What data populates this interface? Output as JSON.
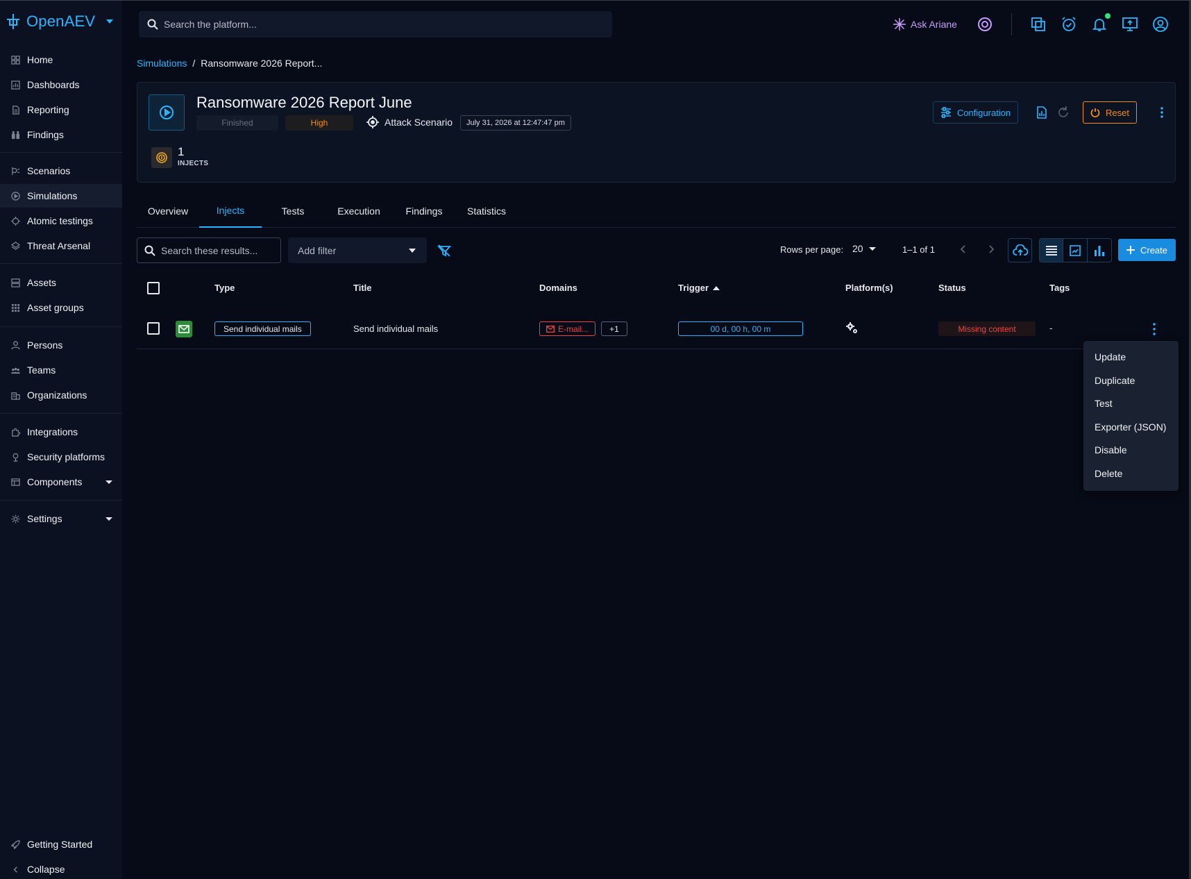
{
  "app": {
    "name": "OpenAEV"
  },
  "topbar": {
    "search_placeholder": "Search the platform...",
    "ask_ariane": "Ask Ariane"
  },
  "sidebar": {
    "groups": [
      [
        "Home",
        "Dashboards",
        "Reporting",
        "Findings"
      ],
      [
        "Scenarios",
        "Simulations",
        "Atomic testings",
        "Threat Arsenal"
      ],
      [
        "Assets",
        "Asset groups"
      ],
      [
        "Persons",
        "Teams",
        "Organizations"
      ],
      [
        "Integrations",
        "Security platforms",
        "Components"
      ],
      [
        "Settings"
      ]
    ],
    "active": "Simulations",
    "getting_started": "Getting Started",
    "collapse": "Collapse"
  },
  "breadcrumb": {
    "parent": "Simulations",
    "separator": "/",
    "current": "Ransomware 2026 Report..."
  },
  "simulation": {
    "title": "Ransomware 2026 Report June",
    "status": "Finished",
    "severity": "High",
    "category": "Attack Scenario",
    "date": "July 31, 2026 at 12:47:47 pm",
    "injects_count": "1",
    "injects_label": "INJECTS",
    "configuration_label": "Configuration",
    "reset_label": "Reset"
  },
  "tabs": [
    "Overview",
    "Injects",
    "Tests",
    "Execution",
    "Findings",
    "Statistics"
  ],
  "active_tab": "Injects",
  "toolbar": {
    "search_placeholder": "Search these results...",
    "add_filter": "Add filter",
    "rows_per_page_label": "Rows per page:",
    "rows_per_page": "20",
    "pagination": "1–1 of 1",
    "create_label": "Create"
  },
  "table": {
    "columns": [
      "Type",
      "Title",
      "Domains",
      "Trigger",
      "Platform(s)",
      "Status",
      "Tags"
    ],
    "rows": [
      {
        "type": "Send individual mails",
        "title": "Send individual mails",
        "domain": "E-mail...",
        "domain_more": "+1",
        "trigger": "00 d, 00 h, 00 m",
        "status": "Missing content",
        "tags": "-"
      }
    ]
  },
  "context_menu": [
    "Update",
    "Duplicate",
    "Test",
    "Exporter (JSON)",
    "Disable",
    "Delete"
  ],
  "colors": {
    "accent": "#2bb4ff",
    "warning": "#f28c1b",
    "danger": "#ef4444",
    "background": "#070b17",
    "sidebar": "#0b1120"
  }
}
